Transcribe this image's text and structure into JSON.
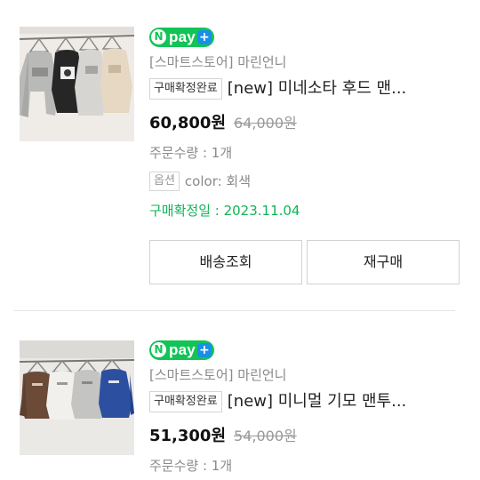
{
  "orders": [
    {
      "npay_label": "pay",
      "store": "[스마트스토어] 마린언니",
      "status": "구매확정완료",
      "product_name": "[new] 미네소타 후드 맨...",
      "price": "60,800원",
      "original_price": "64,000원",
      "quantity": "주문수량 : 1개",
      "option_label": "옵션",
      "option_value": "color: 회색",
      "confirm_date": "구매확정일 : 2023.11.04",
      "buttons": {
        "tracking": "배송조회",
        "rebuy": "재구매"
      }
    },
    {
      "npay_label": "pay",
      "store": "[스마트스토어] 마린언니",
      "status": "구매확정완료",
      "product_name": "[new] 미니멀 기모 맨투...",
      "price": "51,300원",
      "original_price": "54,000원",
      "quantity": "주문수량 : 1개"
    }
  ],
  "colors": {
    "npay_green": "#12c456",
    "confirm_green": "#0eb556",
    "plus_blue": "#1a8fe8"
  }
}
